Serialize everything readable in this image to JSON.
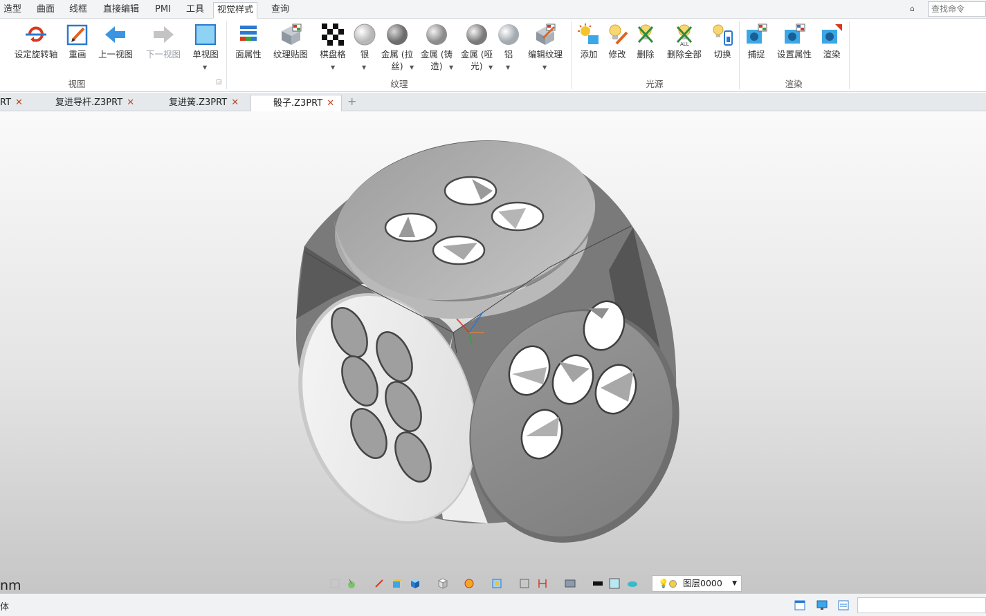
{
  "menu": {
    "tabs": [
      "造型",
      "曲面",
      "线框",
      "直接编辑",
      "PMI",
      "工具",
      "视觉样式",
      "查询"
    ],
    "active_tab": "视觉样式",
    "search_placeholder": "查找命令"
  },
  "ribbon": {
    "view_group": {
      "label": "视图",
      "buttons": [
        "设定旋转轴",
        "重画",
        "上一视图",
        "下一视图",
        "单视图"
      ]
    },
    "texture_group": {
      "label": "纹理",
      "buttons": [
        "面属性",
        "纹理贴图",
        "棋盘格",
        "银",
        "金属 (拉\n丝)",
        "金属 (铸\n造)",
        "金属 (哑\n光)",
        "铝",
        "编辑纹理"
      ]
    },
    "light_group": {
      "label": "光源",
      "buttons": [
        "添加",
        "修改",
        "删除",
        "删除全部",
        "切换"
      ]
    },
    "render_group": {
      "label": "渲染",
      "buttons": [
        "捕捉",
        "设置属性",
        "渲染"
      ]
    }
  },
  "documents": {
    "tabs": [
      "RT",
      "复进导杆.Z3PRT",
      "复进簧.Z3PRT",
      "骰子.Z3PRT"
    ],
    "active": "骰子.Z3PRT",
    "close_symbol": "✕",
    "new_tab_symbol": "+"
  },
  "viewport": {
    "unit_label": "nm",
    "layer_label": "图层0000"
  },
  "statusbar": {
    "text": "体"
  },
  "colors": {
    "accent_blue": "#2b79d0",
    "close_red": "#b84a2a",
    "face_light": "#ececec",
    "face_dark": "#8c8c8c"
  }
}
